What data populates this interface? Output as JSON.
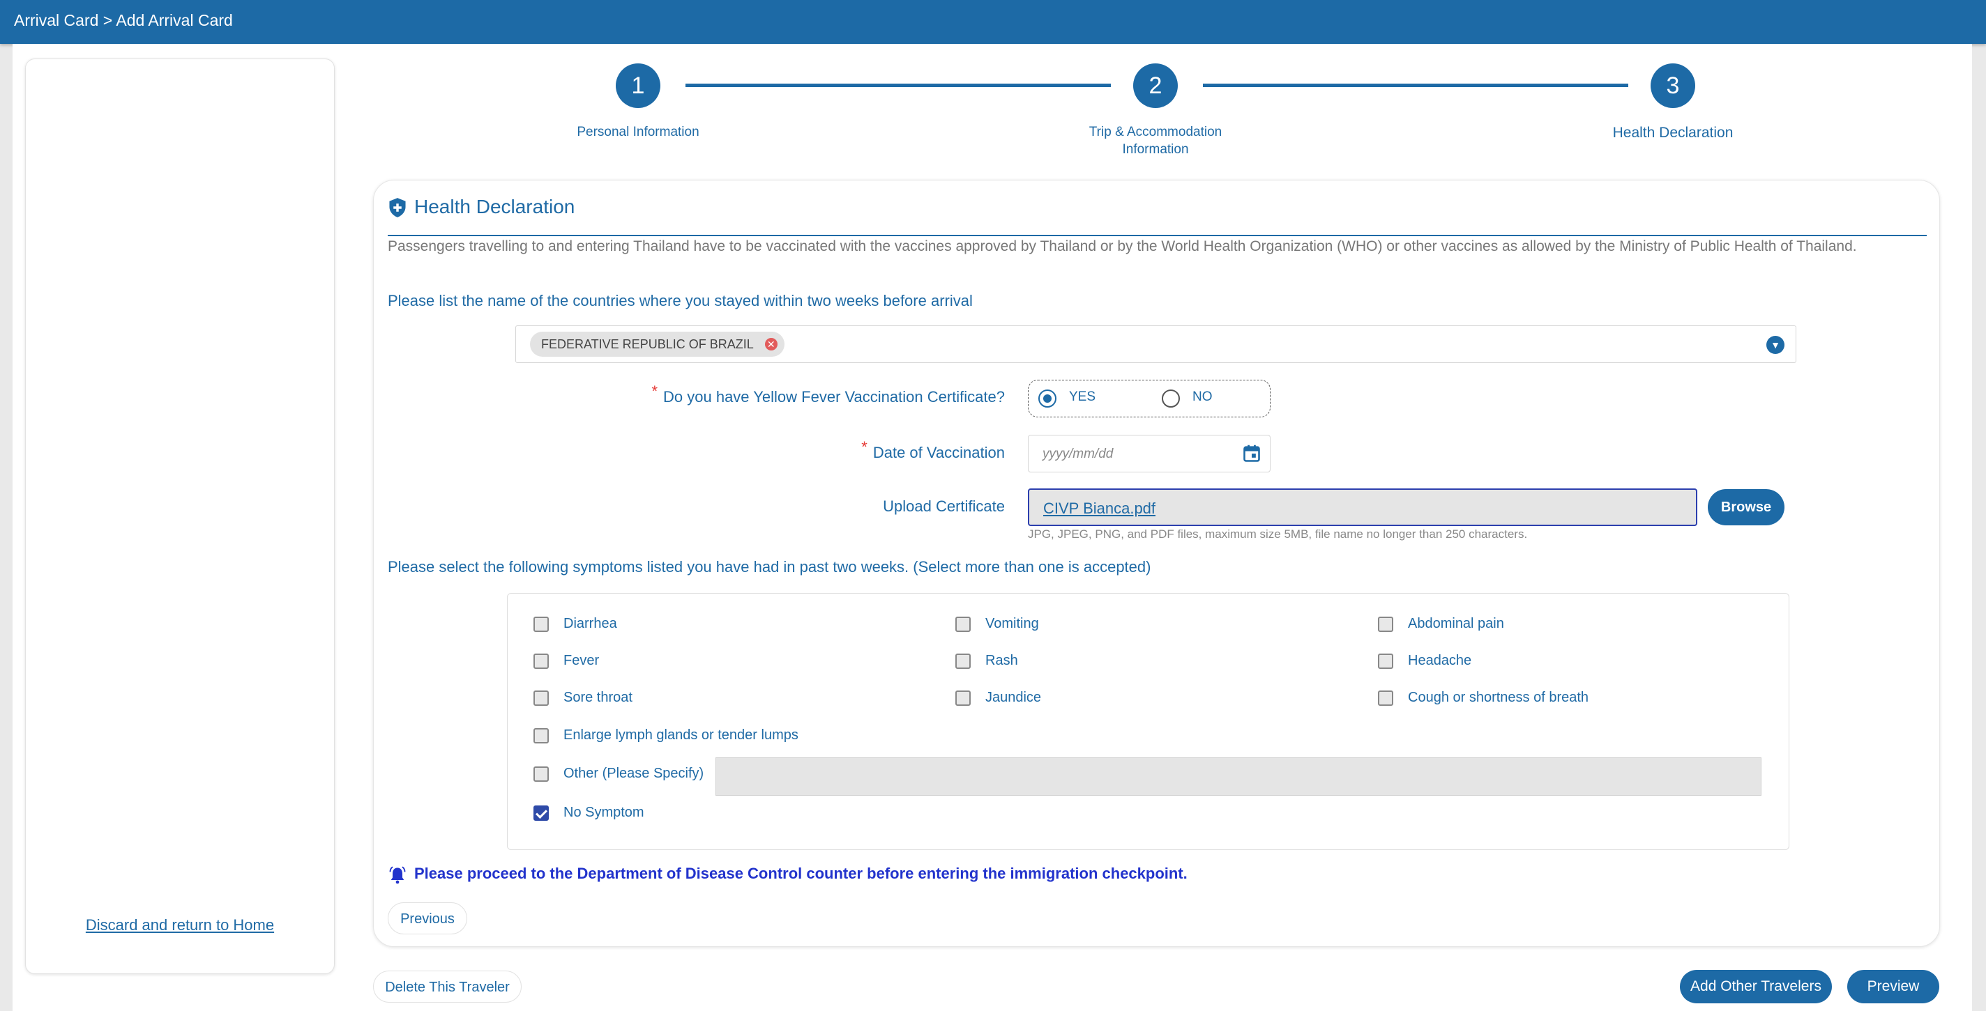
{
  "header": {
    "breadcrumb": "Arrival Card > Add Arrival Card"
  },
  "sidebar": {
    "discard_link": "Discard and return to Home"
  },
  "stepper": {
    "steps": [
      {
        "number": "1",
        "label": "Personal Information"
      },
      {
        "number": "2",
        "label_line1": "Trip & Accommodation",
        "label_line2": "Information"
      },
      {
        "number": "3",
        "label": "Health Declaration"
      }
    ]
  },
  "form": {
    "section_title": "Health Declaration",
    "intro_text": "Passengers travelling to and entering Thailand have to be vaccinated with the vaccines approved by Thailand or by the World Health Organization (WHO) or other vaccines as allowed by the Ministry of Public Health of Thailand.",
    "countries_question": "Please list the name of the countries where you stayed within two weeks before arrival",
    "countries_selected": [
      "FEDERATIVE REPUBLIC OF BRAZIL"
    ],
    "yellow_fever_label": "Do you have Yellow Fever Vaccination Certificate?",
    "yellow_fever_options": {
      "yes": "YES",
      "no": "NO"
    },
    "yellow_fever_value": "YES",
    "required_mark": "*",
    "vaccination_date_label": "Date of Vaccination",
    "vaccination_date_placeholder": "yyyy/mm/dd",
    "upload_label": "Upload Certificate",
    "uploaded_file": "CIVP Bianca.pdf",
    "browse_button": "Browse",
    "upload_hint": "JPG, JPEG, PNG, and PDF files, maximum size 5MB, file name no longer than 250 characters.",
    "symptoms_question": "Please select the following symptoms listed you have had in past two weeks. (Select more than one is accepted)",
    "symptoms": {
      "diarrhea": {
        "label": "Diarrhea",
        "checked": false
      },
      "vomiting": {
        "label": "Vomiting",
        "checked": false
      },
      "abdominal_pain": {
        "label": "Abdominal pain",
        "checked": false
      },
      "fever": {
        "label": "Fever",
        "checked": false
      },
      "rash": {
        "label": "Rash",
        "checked": false
      },
      "headache": {
        "label": "Headache",
        "checked": false
      },
      "sore_throat": {
        "label": "Sore throat",
        "checked": false
      },
      "jaundice": {
        "label": "Jaundice",
        "checked": false
      },
      "cough": {
        "label": "Cough or shortness of breath",
        "checked": false
      },
      "lymph": {
        "label": "Enlarge lymph glands or tender lumps",
        "checked": false
      },
      "other": {
        "label": "Other (Please Specify)",
        "checked": false
      },
      "no_symptom": {
        "label": "No Symptom",
        "checked": true
      }
    },
    "other_specify_value": "",
    "alert_text": "Please proceed to the Department of Disease Control counter before entering the immigration checkpoint.",
    "previous_button": "Previous"
  },
  "footer": {
    "delete_button": "Delete This Traveler",
    "add_travelers_button": "Add Other Travelers",
    "preview_button": "Preview"
  },
  "colors": {
    "primary": "#1d6aa6",
    "alert": "#2233cc",
    "required": "#e53935"
  },
  "icons": [
    "shield-plus-icon",
    "close-circle-icon",
    "chevron-down-icon",
    "calendar-icon",
    "alarm-bell-icon",
    "checkbox-check-icon"
  ]
}
